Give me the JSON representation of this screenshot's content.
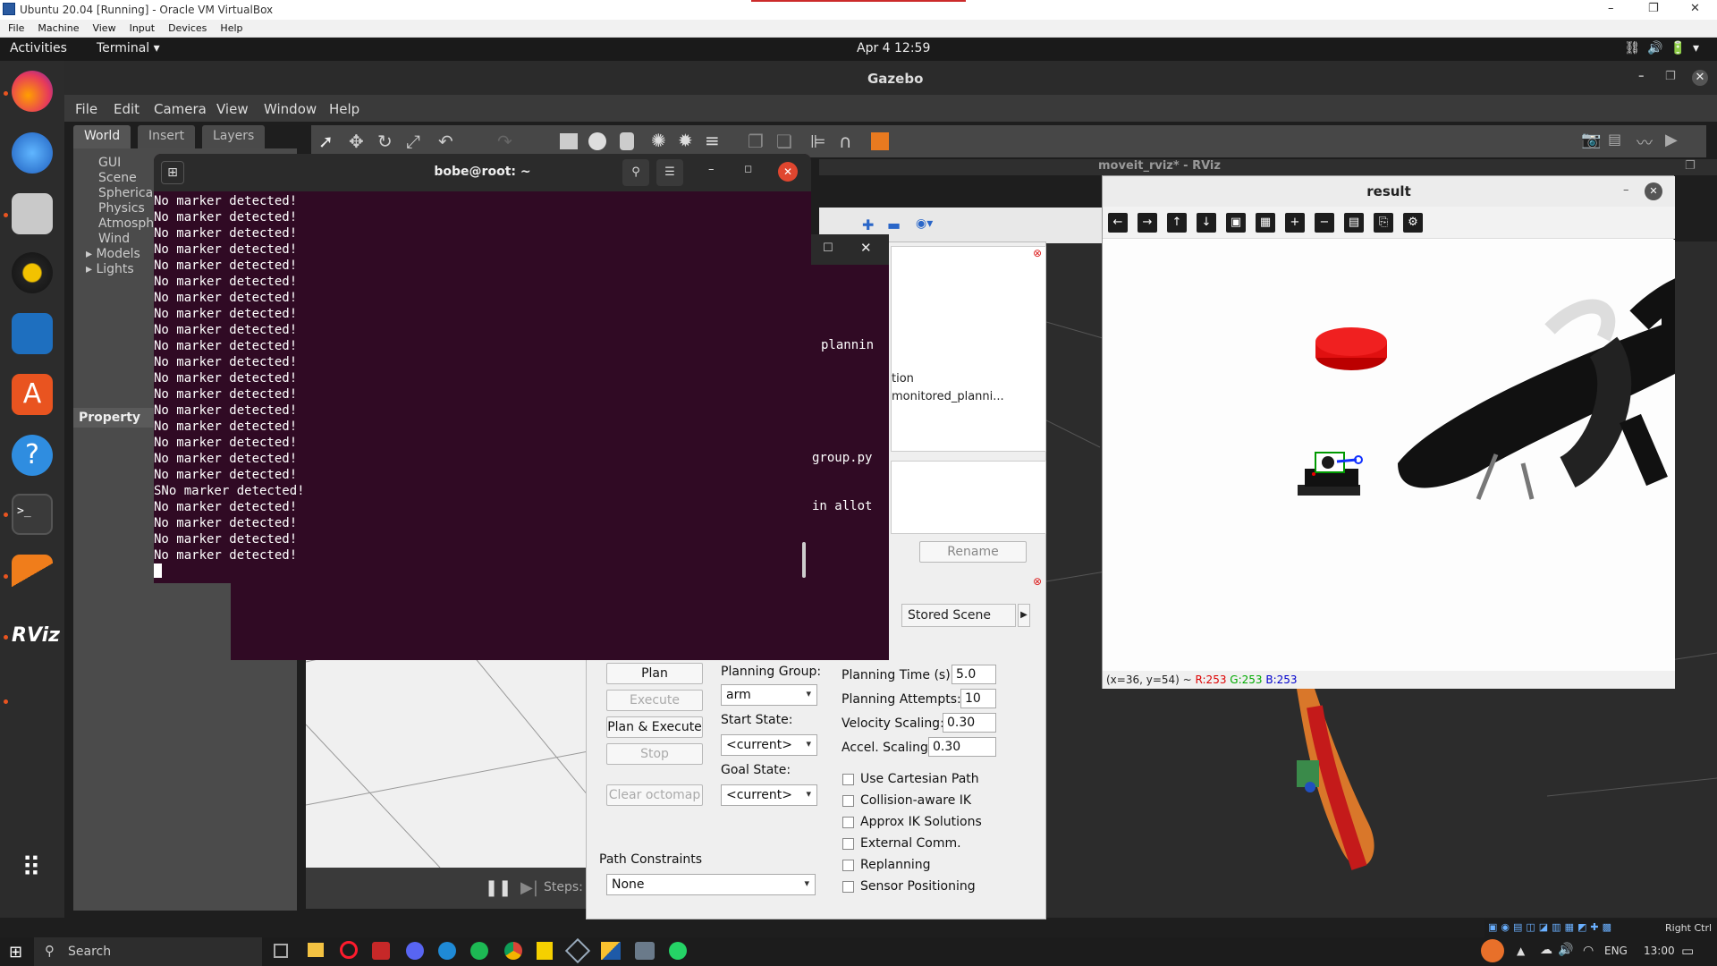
{
  "vbox": {
    "title": "Ubuntu 20.04 [Running] - Oracle VM VirtualBox",
    "menu": [
      "File",
      "Machine",
      "View",
      "Input",
      "Devices",
      "Help"
    ],
    "status_host_key": "Right Ctrl"
  },
  "ubuntu_bar": {
    "activities": "Activities",
    "app": "Terminal ▾",
    "clock": "Apr 4  12:59"
  },
  "gazebo": {
    "title": "Gazebo",
    "menu": [
      "File",
      "Edit",
      "Camera",
      "View",
      "Window",
      "Help"
    ],
    "tabs": [
      "World",
      "Insert",
      "Layers"
    ],
    "tree": [
      "GUI",
      "Scene",
      "Spherical",
      "Physics",
      "Atmosph",
      "Wind",
      "▸ Models",
      "▸ Lights"
    ],
    "property_header": "Property",
    "steps_label": "Steps:"
  },
  "rviz": {
    "title": "moveit_rviz* - RViz",
    "rename_button": "Rename",
    "stored_scenes_tab": "Stored Scene",
    "bg_text": [
      "plannin",
      "tion",
      "monitored_planni...",
      "group.py",
      "in allot"
    ],
    "buttons": {
      "plan": "Plan",
      "execute": "Execute",
      "plan_execute": "Plan & Execute",
      "stop": "Stop",
      "clear_octomap": "Clear octomap"
    },
    "planning_group_label": "Planning Group:",
    "planning_group_value": "arm",
    "start_state_label": "Start State:",
    "start_state_value": "<current>",
    "goal_state_label": "Goal State:",
    "goal_state_value": "<current>",
    "planning_time_label": "Planning Time (s):",
    "planning_time_value": "5.0",
    "planning_attempts_label": "Planning Attempts:",
    "planning_attempts_value": "10",
    "velocity_label": "Velocity Scaling:",
    "velocity_value": "0.30",
    "accel_label": "Accel. Scaling:",
    "accel_value": "0.30",
    "checkboxes": [
      "Use Cartesian Path",
      "Collision-aware IK",
      "Approx IK Solutions",
      "External Comm.",
      "Replanning",
      "Sensor Positioning"
    ],
    "path_constraints_label": "Path Constraints",
    "path_constraints_value": "None"
  },
  "terminal": {
    "title": "bobe@root: ~",
    "lines": [
      "No marker detected!",
      "No marker detected!",
      "No marker detected!",
      "No marker detected!",
      "No marker detected!",
      "No marker detected!",
      "No marker detected!",
      "No marker detected!",
      "No marker detected!",
      "No marker detected!",
      "No marker detected!",
      "No marker detected!",
      "No marker detected!",
      "No marker detected!",
      "No marker detected!",
      "No marker detected!",
      "No marker detected!",
      "No marker detected!",
      "SNo marker detected!",
      "No marker detected!",
      "No marker detected!",
      "No marker detected!",
      "No marker detected!"
    ]
  },
  "result": {
    "title": "result",
    "status_coords": "(x=36, y=54) ~",
    "status_r": "R:253",
    "status_g": "G:253",
    "status_b": "B:253"
  },
  "taskbar": {
    "search_placeholder": "Search",
    "lang": "ENG",
    "time": "13:00"
  },
  "colors": {
    "terminal_bg": "#300a24",
    "ubuntu_orange": "#e95420",
    "close_red": "#e0462f"
  }
}
